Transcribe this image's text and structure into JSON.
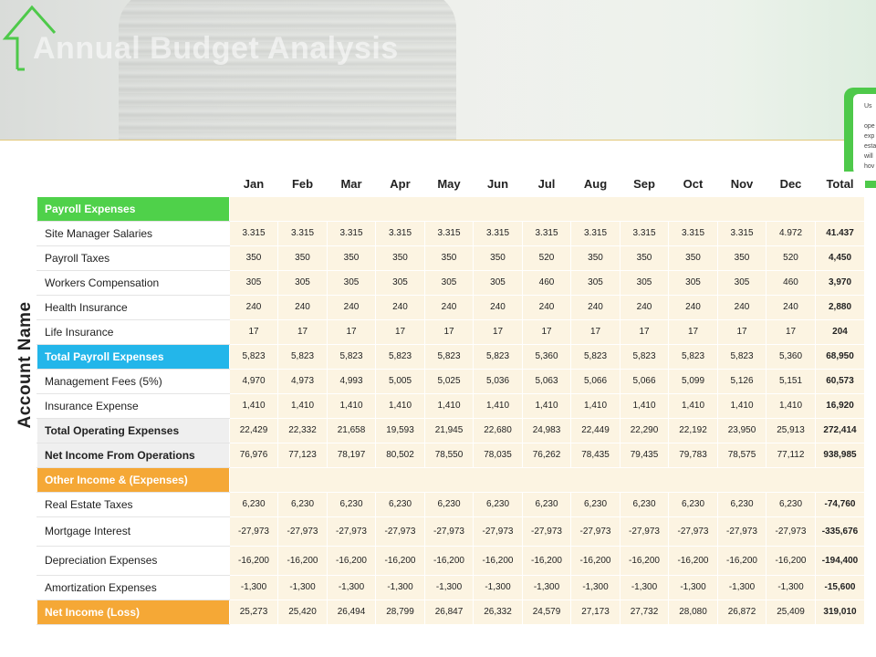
{
  "header": {
    "title": "Annual Budget Analysis"
  },
  "callout": {
    "lines": [
      "Us",
      "",
      "ope",
      "exp",
      "esta",
      "will",
      "hov"
    ]
  },
  "side_label": "Account Name",
  "columns": [
    "Jan",
    "Feb",
    "Mar",
    "Apr",
    "May",
    "Jun",
    "Jul",
    "Aug",
    "Sep",
    "Oct",
    "Nov",
    "Dec",
    "Total"
  ],
  "rows": [
    {
      "name": "Payroll Expenses",
      "style": "green",
      "values": []
    },
    {
      "name": "Site Manager Salaries",
      "style": "",
      "values": [
        "3.315",
        "3.315",
        "3.315",
        "3.315",
        "3.315",
        "3.315",
        "3.315",
        "3.315",
        "3.315",
        "3.315",
        "3.315",
        "4.972",
        "41.437"
      ]
    },
    {
      "name": "Payroll Taxes",
      "style": "",
      "values": [
        "350",
        "350",
        "350",
        "350",
        "350",
        "350",
        "520",
        "350",
        "350",
        "350",
        "350",
        "520",
        "4,450"
      ]
    },
    {
      "name": "Workers Compensation",
      "style": "",
      "values": [
        "305",
        "305",
        "305",
        "305",
        "305",
        "305",
        "460",
        "305",
        "305",
        "305",
        "305",
        "460",
        "3,970"
      ]
    },
    {
      "name": "Health Insurance",
      "style": "",
      "values": [
        "240",
        "240",
        "240",
        "240",
        "240",
        "240",
        "240",
        "240",
        "240",
        "240",
        "240",
        "240",
        "2,880"
      ]
    },
    {
      "name": "Life Insurance",
      "style": "",
      "values": [
        "17",
        "17",
        "17",
        "17",
        "17",
        "17",
        "17",
        "17",
        "17",
        "17",
        "17",
        "17",
        "204"
      ]
    },
    {
      "name": "Total Payroll Expenses",
      "style": "blue",
      "values": [
        "5,823",
        "5,823",
        "5,823",
        "5,823",
        "5,823",
        "5,823",
        "5,360",
        "5,823",
        "5,823",
        "5,823",
        "5,823",
        "5,360",
        "68,950"
      ]
    },
    {
      "name": "Management Fees (5%)",
      "style": "",
      "values": [
        "4,970",
        "4,973",
        "4,993",
        "5,005",
        "5,025",
        "5,036",
        "5,063",
        "5,066",
        "5,066",
        "5,099",
        "5,126",
        "5,151",
        "60,573"
      ]
    },
    {
      "name": "Insurance Expense",
      "style": "",
      "values": [
        "1,410",
        "1,410",
        "1,410",
        "1,410",
        "1,410",
        "1,410",
        "1,410",
        "1,410",
        "1,410",
        "1,410",
        "1,410",
        "1,410",
        "16,920"
      ]
    },
    {
      "name": "Total Operating Expenses",
      "style": "gray",
      "values": [
        "22,429",
        "22,332",
        "21,658",
        "19,593",
        "21,945",
        "22,680",
        "24,983",
        "22,449",
        "22,290",
        "22,192",
        "23,950",
        "25,913",
        "272,414"
      ]
    },
    {
      "name": "Net Income From Operations",
      "style": "gray",
      "values": [
        "76,976",
        "77,123",
        "78,197",
        "80,502",
        "78,550",
        "78,035",
        "76,262",
        "78,435",
        "79,435",
        "79,783",
        "78,575",
        "77,112",
        "938,985"
      ]
    },
    {
      "name": "Other Income & (Expenses)",
      "style": "orange",
      "values": []
    },
    {
      "name": "Real Estate Taxes",
      "style": "",
      "values": [
        "6,230",
        "6,230",
        "6,230",
        "6,230",
        "6,230",
        "6,230",
        "6,230",
        "6,230",
        "6,230",
        "6,230",
        "6,230",
        "6,230",
        "-74,760"
      ]
    },
    {
      "name": "Mortgage Interest",
      "style": "tall",
      "values": [
        "-27,973",
        "-27,973",
        "-27,973",
        "-27,973",
        "-27,973",
        "-27,973",
        "-27,973",
        "-27,973",
        "-27,973",
        "-27,973",
        "-27,973",
        "-27,973",
        "-335,676"
      ]
    },
    {
      "name": "Depreciation Expenses",
      "style": "tall",
      "values": [
        "-16,200",
        "-16,200",
        "-16,200",
        "-16,200",
        "-16,200",
        "-16,200",
        "-16,200",
        "-16,200",
        "-16,200",
        "-16,200",
        "-16,200",
        "-16,200",
        "-194,400"
      ]
    },
    {
      "name": "Amortization Expenses",
      "style": "",
      "values": [
        "-1,300",
        "-1,300",
        "-1,300",
        "-1,300",
        "-1,300",
        "-1,300",
        "-1,300",
        "-1,300",
        "-1,300",
        "-1,300",
        "-1,300",
        "-1,300",
        "-15,600"
      ]
    },
    {
      "name": "Net Income (Loss)",
      "style": "orange",
      "values": [
        "25,273",
        "25,420",
        "26,494",
        "28,799",
        "26,847",
        "26,332",
        "24,579",
        "27,173",
        "27,732",
        "28,080",
        "26,872",
        "25,409",
        "319,010"
      ]
    }
  ],
  "colors": {
    "payroll_header": "#4fd14a",
    "total_payroll": "#23b6ea",
    "other_income": "#f5a836",
    "cell_bg": "#fcf4e2",
    "accent_green": "#4ec94a"
  }
}
